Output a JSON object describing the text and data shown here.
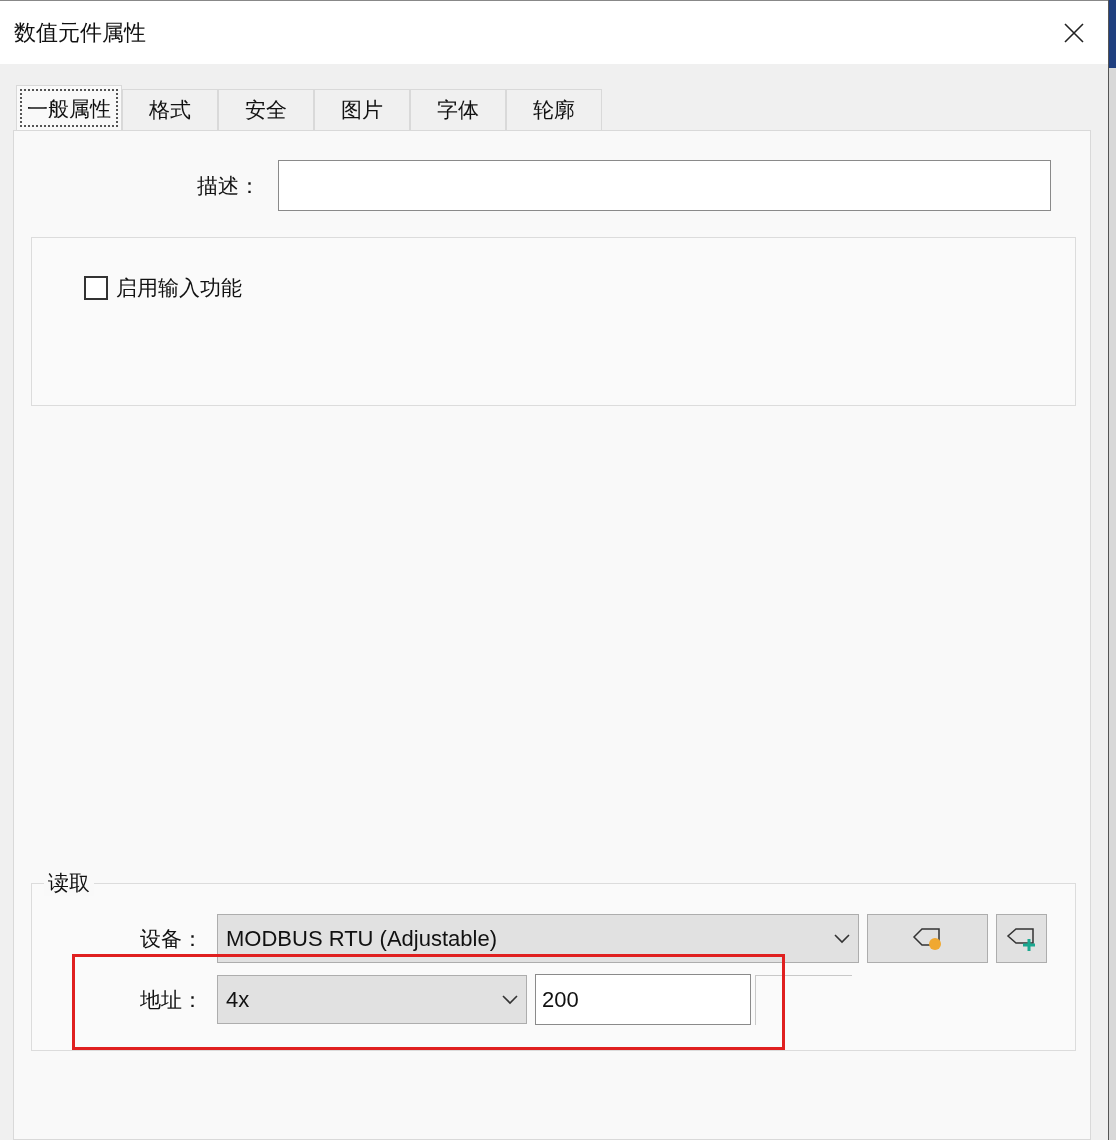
{
  "window": {
    "title": "数值元件属性"
  },
  "tabs": [
    {
      "label": "一般属性",
      "selected": true
    },
    {
      "label": "格式",
      "selected": false
    },
    {
      "label": "安全",
      "selected": false
    },
    {
      "label": "图片",
      "selected": false
    },
    {
      "label": "字体",
      "selected": false
    },
    {
      "label": "轮廓",
      "selected": false
    }
  ],
  "description": {
    "label": "描述："
  },
  "input_function": {
    "label": "启用输入功能",
    "checked": false
  },
  "read_group": {
    "title": "读取",
    "device": {
      "label": "设备：",
      "value": "MODBUS RTU (Adjustable)"
    },
    "address": {
      "label": "地址：",
      "type": "4x",
      "value": "200"
    }
  }
}
